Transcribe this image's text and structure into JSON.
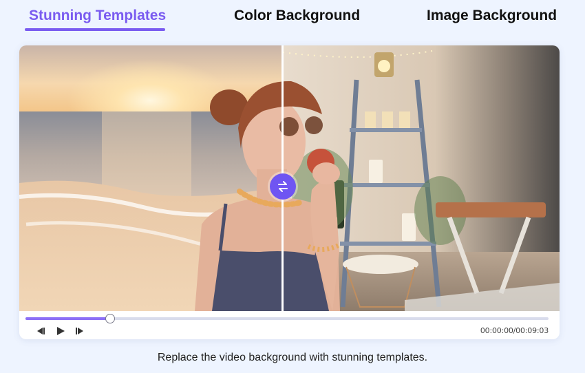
{
  "tabs": [
    {
      "label": "Stunning Templates",
      "active": true
    },
    {
      "label": "Color Background",
      "active": false
    },
    {
      "label": "Image Background",
      "active": false
    }
  ],
  "player": {
    "progress_fraction": 0.162,
    "time_display": "00:00:00/00:09:03",
    "icons": {
      "swap": "swap-arrows-icon",
      "prev": "skip-back-icon",
      "play": "play-icon",
      "next": "skip-forward-icon"
    }
  },
  "caption": "Replace the video background with stunning templates.",
  "colors": {
    "accent": "#7a5cf0",
    "handle": "#6f55f2",
    "page_bg": "#eef4ff"
  }
}
